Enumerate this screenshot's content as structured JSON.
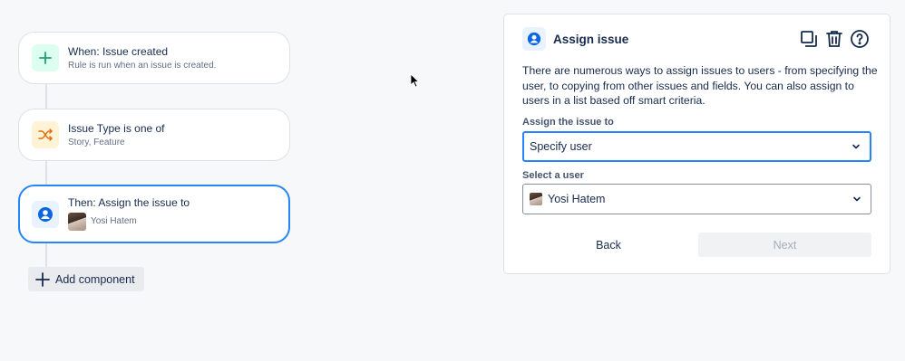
{
  "rule": {
    "trigger": {
      "title": "When: Issue created",
      "subtitle": "Rule is run when an issue is created.",
      "icon": "plus-icon",
      "color": "#22a06b"
    },
    "condition": {
      "title": "Issue Type is one of",
      "subtitle": "Story, Feature",
      "icon": "shuffle-icon",
      "color": "#e56910"
    },
    "action": {
      "title": "Then: Assign the issue to",
      "subtitle": "Yosi Hatem",
      "icon": "user-circle-icon",
      "color": "#0c66e4"
    },
    "add_component_label": "Add component"
  },
  "panel": {
    "title": "Assign issue",
    "description": "There are numerous ways to assign issues to users - from specifying the user, to copying from other issues and fields. You can also assign to users in a list based off smart criteria.",
    "assign_label": "Assign the issue to",
    "assign_value": "Specify user",
    "user_label": "Select a user",
    "user_value": "Yosi Hatem",
    "back_label": "Back",
    "next_label": "Next",
    "actions": [
      "duplicate-icon",
      "trash-icon",
      "help-icon"
    ]
  },
  "colors": {
    "accent": "#2684ff",
    "background": "#f7f8f9"
  }
}
